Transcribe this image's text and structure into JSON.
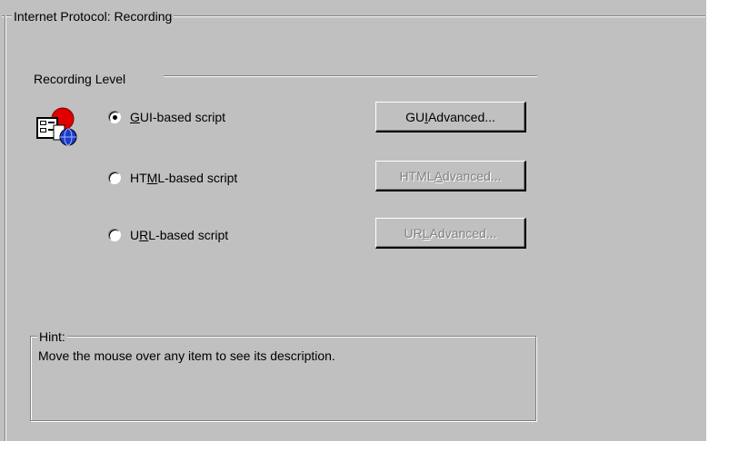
{
  "group": {
    "title": "Internet Protocol: Recording"
  },
  "recording_level": {
    "label": "Recording Level",
    "icon": "application-recording-icon",
    "options": [
      {
        "label_pre": "",
        "mnemonic": "G",
        "label_post": "UI-based script",
        "selected": true,
        "button": {
          "pre": "GU",
          "mnemonic": "I",
          "post": " Advanced...",
          "enabled": true
        }
      },
      {
        "label_pre": "HT",
        "mnemonic": "M",
        "label_post": "L-based script",
        "selected": false,
        "button": {
          "pre": "HTML ",
          "mnemonic": "A",
          "post": "dvanced...",
          "enabled": false
        }
      },
      {
        "label_pre": "U",
        "mnemonic": "R",
        "label_post": "L-based script",
        "selected": false,
        "button": {
          "pre": "UR",
          "mnemonic": "L",
          "post": " Advanced...",
          "enabled": false
        }
      }
    ]
  },
  "hint": {
    "label": "Hint:",
    "text": "Move the mouse over any item to see its description."
  },
  "colors": {
    "face": "#c0c0c0",
    "shadow": "#808080",
    "highlight": "#ffffff",
    "icon_red": "#e00000",
    "icon_blue": "#1e3cc8"
  }
}
